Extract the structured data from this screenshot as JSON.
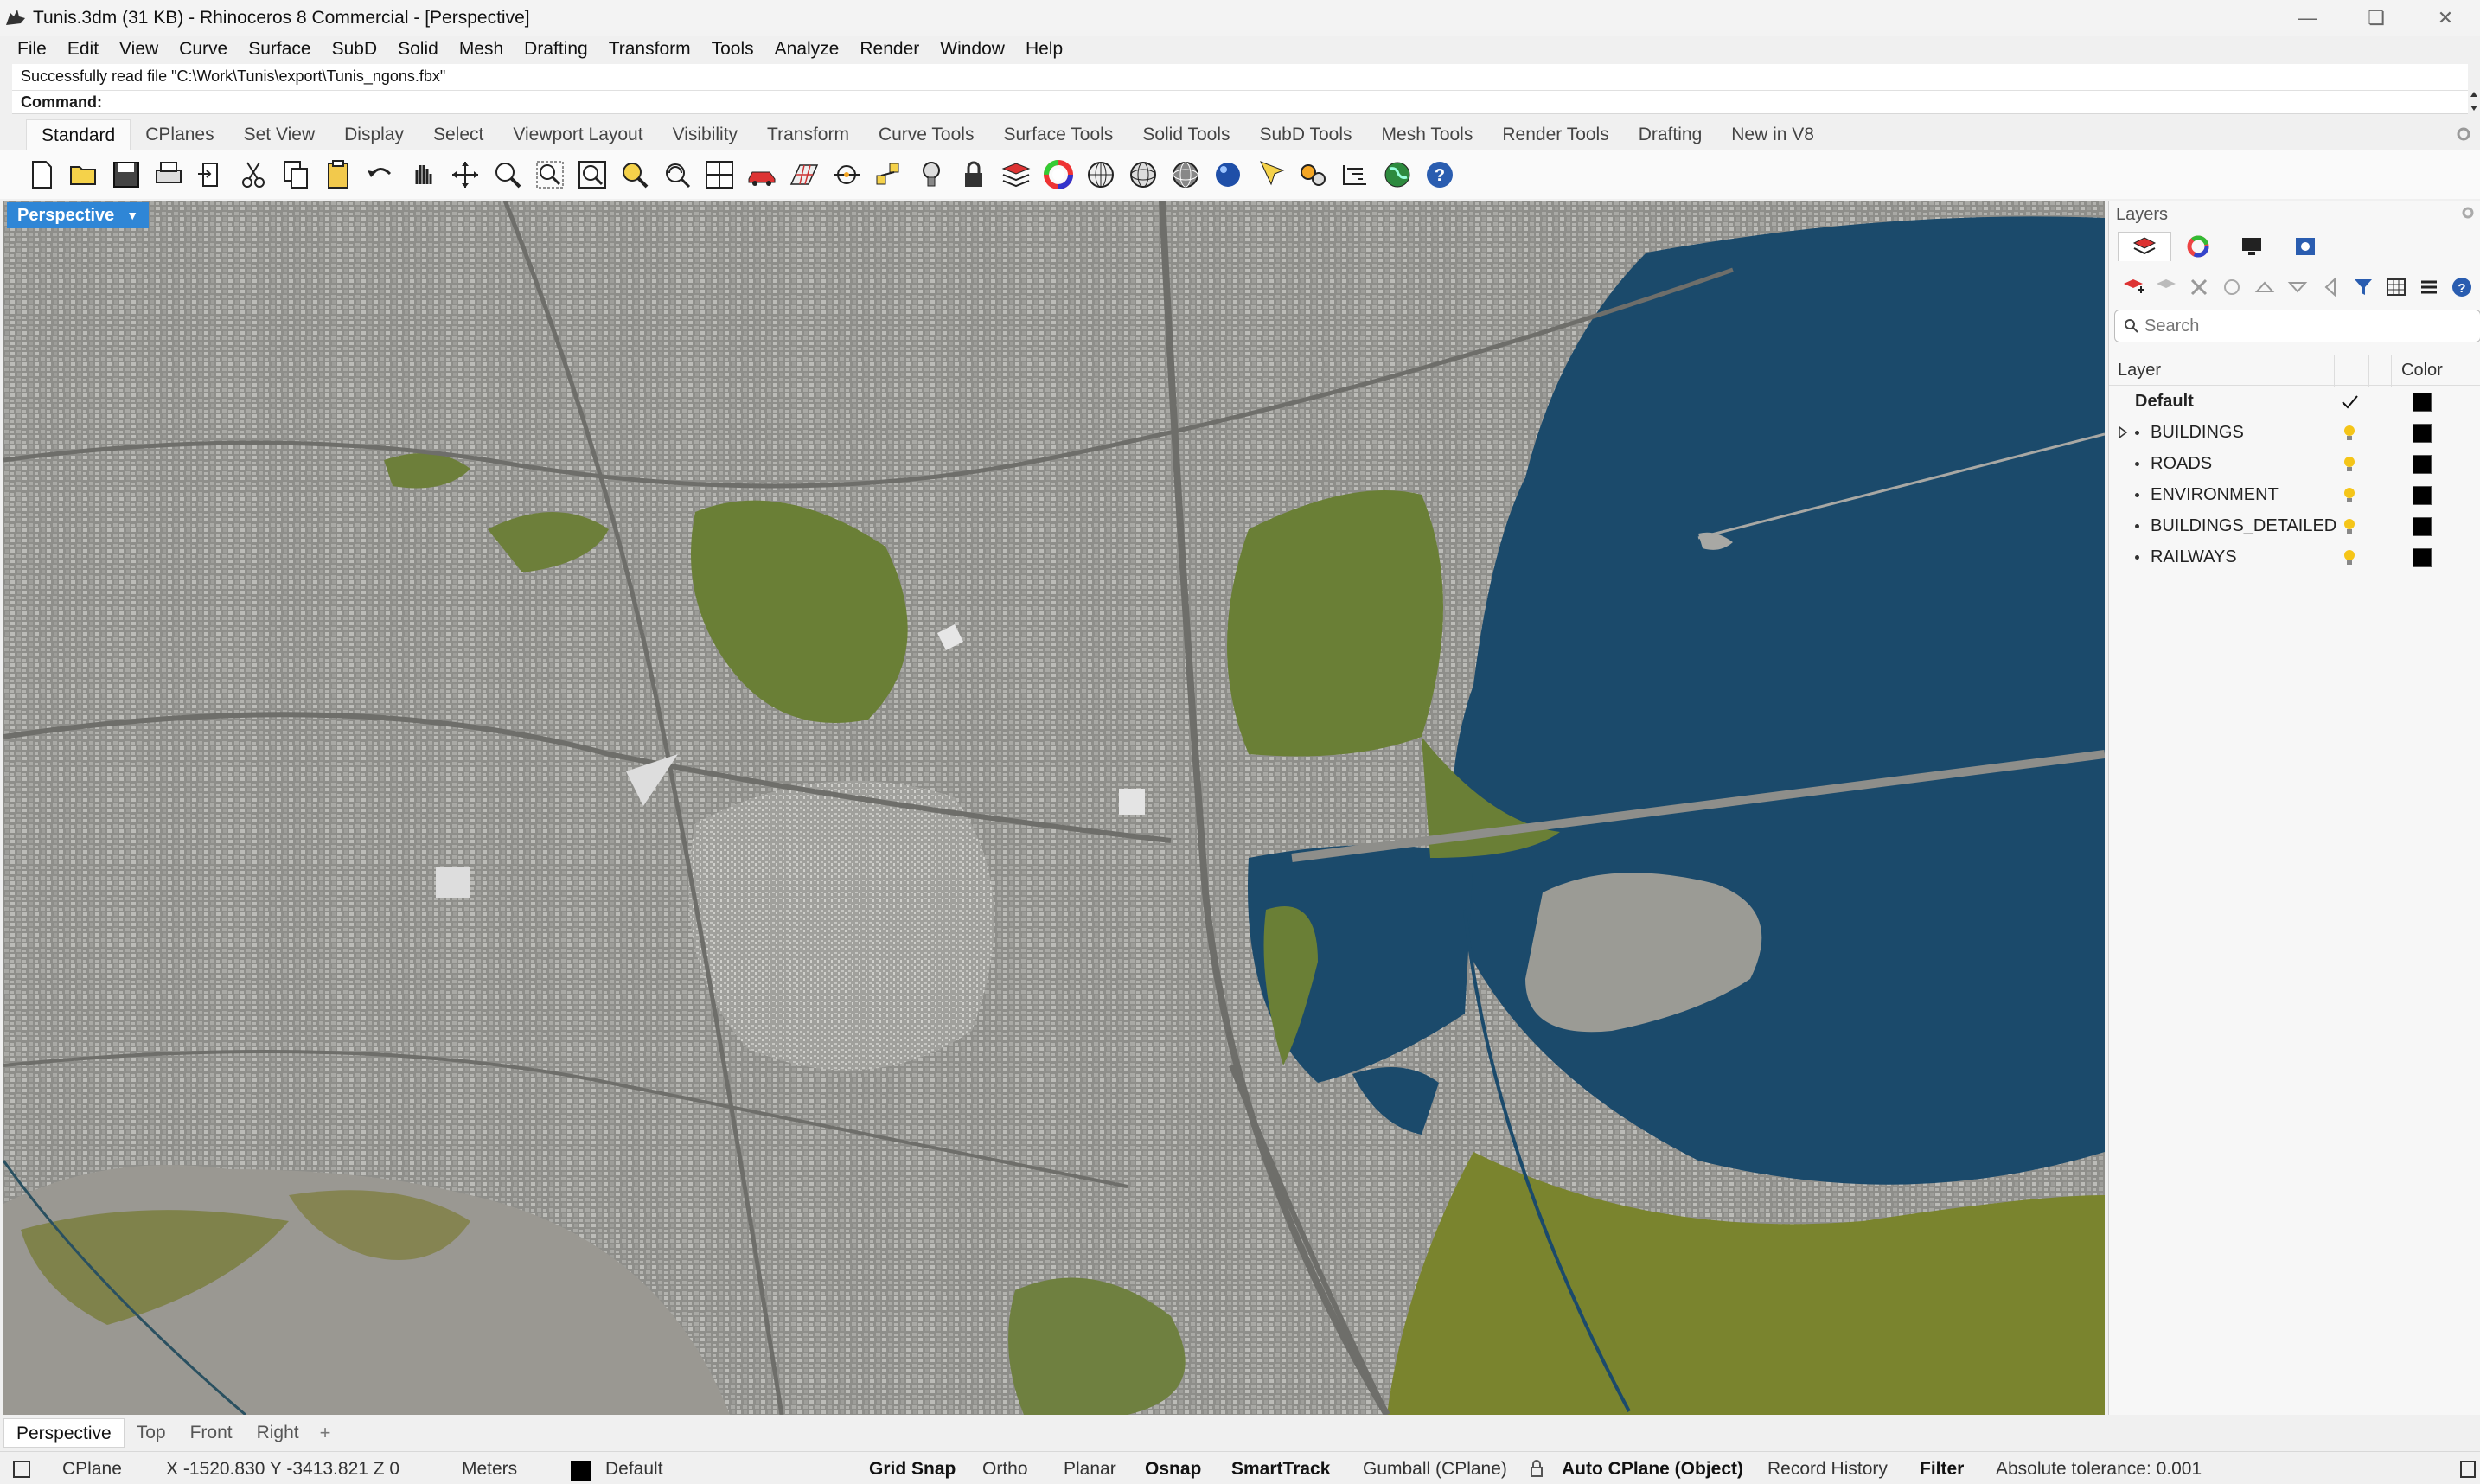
{
  "window": {
    "title": "Tunis.3dm (31 KB) - Rhinoceros 8 Commercial - [Perspective]",
    "controls": [
      "minimize-icon",
      "maximize-icon",
      "close-icon"
    ]
  },
  "menu": [
    "File",
    "Edit",
    "View",
    "Curve",
    "Surface",
    "SubD",
    "Solid",
    "Mesh",
    "Drafting",
    "Transform",
    "Tools",
    "Analyze",
    "Render",
    "Window",
    "Help"
  ],
  "command": {
    "history": "Successfully read file \"C:\\Work\\Tunis\\export\\Tunis_ngons.fbx\"",
    "prompt": "Command:",
    "value": ""
  },
  "toolbar_tabs": [
    "Standard",
    "CPlanes",
    "Set View",
    "Display",
    "Select",
    "Viewport Layout",
    "Visibility",
    "Transform",
    "Curve Tools",
    "Surface Tools",
    "Solid Tools",
    "SubD Tools",
    "Mesh Tools",
    "Render Tools",
    "Drafting",
    "New in V8"
  ],
  "toolbar_icons": [
    "new-icon",
    "open-icon",
    "save-icon",
    "print-icon",
    "import-icon",
    "cut-icon",
    "copy-icon",
    "paste-icon",
    "undo-icon",
    "pan-icon",
    "rotate-view-icon",
    "zoom-icon",
    "zoom-window-icon",
    "zoom-extents-icon",
    "zoom-selected-icon",
    "rotate-icon",
    "four-viewports-icon",
    "car-icon",
    "grid-icon",
    "snap-icon",
    "points-icon",
    "light-icon",
    "lock-icon",
    "layer-icon",
    "color-wheel-icon",
    "render-ball-icon",
    "sphere-wire-icon",
    "sphere-shaded-icon",
    "blue-sphere-icon",
    "hide-icon",
    "options-icon",
    "dimensions-icon",
    "environment-icon",
    "help-icon"
  ],
  "viewport": {
    "name": "Perspective",
    "colors": {
      "water": "#1b4a6b",
      "grass": "#6a7f36",
      "city": "#8b8b86"
    }
  },
  "layers_panel": {
    "title": "Layers",
    "search_placeholder": "Search",
    "col_layer": "Layer",
    "col_color": "Color",
    "rows": [
      {
        "name": "Default",
        "current": true,
        "color": "#000000"
      },
      {
        "name": "BUILDINGS",
        "expandable": true,
        "color": "#000000"
      },
      {
        "name": "ROADS",
        "color": "#000000"
      },
      {
        "name": "ENVIRONMENT",
        "color": "#000000"
      },
      {
        "name": "BUILDINGS_DETAILED",
        "color": "#000000"
      },
      {
        "name": "RAILWAYS",
        "color": "#000000"
      }
    ]
  },
  "viewport_tabs": [
    "Perspective",
    "Top",
    "Front",
    "Right"
  ],
  "statusbar": {
    "cplane": "CPlane",
    "coords": "X -1520.830 Y -3413.821 Z 0",
    "units": "Meters",
    "layer": "Default",
    "grid_snap": "Grid Snap",
    "ortho": "Ortho",
    "planar": "Planar",
    "osnap": "Osnap",
    "smarttrack": "SmartTrack",
    "gumball": "Gumball (CPlane)",
    "auto_cplane": "Auto CPlane (Object)",
    "record_history": "Record History",
    "filter": "Filter",
    "tolerance": "Absolute tolerance: 0.001"
  }
}
